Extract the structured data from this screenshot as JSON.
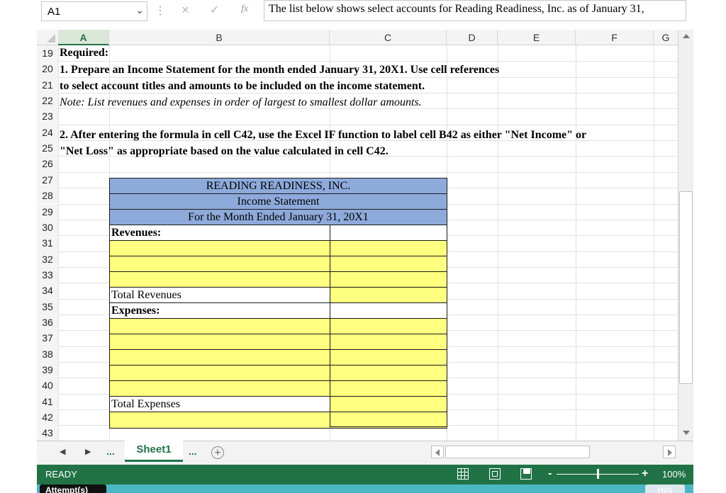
{
  "formula_bar": {
    "name_box": "A1",
    "cancel_icon": "×",
    "enter_icon": "✓",
    "fx_label": "fx",
    "formula": "The list below shows select accounts for Reading Readiness, Inc. as of January 31,"
  },
  "columns": [
    "A",
    "B",
    "C",
    "D",
    "E",
    "F",
    "G"
  ],
  "rows": [
    "19",
    "20",
    "21",
    "22",
    "23",
    "24",
    "25",
    "26",
    "27",
    "28",
    "29",
    "30",
    "31",
    "32",
    "33",
    "34",
    "35",
    "36",
    "37",
    "38",
    "39",
    "40",
    "41",
    "42",
    "43"
  ],
  "cells": {
    "r19": "Required:",
    "r20": "1. Prepare an Income Statement for the month ended January 31, 20X1.  Use cell references",
    "r21": "to select account titles and amounts to be included on the income statement.",
    "r22": "Note:  List revenues and expenses in order of largest to smallest dollar amounts.",
    "r24": "2. After entering the formula in cell C42, use the Excel IF function to label cell B42 as either \"Net Income\" or",
    "r25": "\"Net Loss\" as appropriate based on the value calculated in cell C42."
  },
  "statement": {
    "company": "READING READINESS, INC.",
    "title": "Income Statement",
    "period": "For the Month Ended January 31, 20X1",
    "revenues_label": "Revenues:",
    "total_revenues_label": "Total Revenues",
    "expenses_label": "Expenses:",
    "total_expenses_label": "Total Expenses"
  },
  "sheet_tabs": {
    "prev": "◀",
    "next": "▶",
    "more": "...",
    "active": "Sheet1",
    "more_right": "...",
    "add": "+"
  },
  "status_bar": {
    "ready": "READY",
    "zoom": "100%",
    "minus": "-",
    "plus": "+"
  },
  "footer": {
    "attempts": "Attempt(s)",
    "hint": "Hint"
  },
  "colors": {
    "header_fill": "#8eaadb",
    "input_fill": "#ffff80",
    "status_green": "#217346"
  }
}
